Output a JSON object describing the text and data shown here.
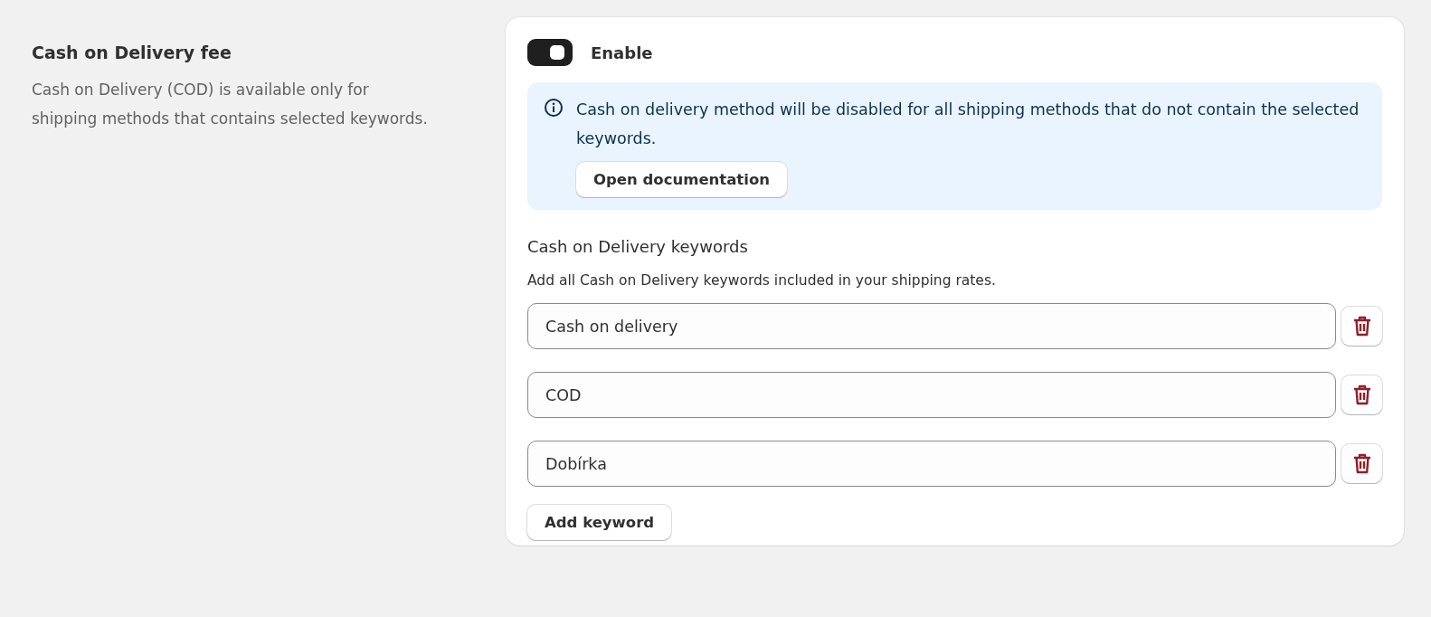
{
  "section": {
    "title": "Cash on Delivery fee",
    "description": "Cash on Delivery (COD) is available only for shipping methods that contains selected keywords."
  },
  "toggle": {
    "label": "Enable",
    "on": true
  },
  "banner": {
    "text": "Cash on delivery method will be disabled for all shipping methods that do not contain the selected keywords.",
    "button": "Open documentation"
  },
  "keywords": {
    "title": "Cash on Delivery keywords",
    "help": "Add all Cash on Delivery keywords included in your shipping rates.",
    "items": [
      {
        "value": "Cash on delivery"
      },
      {
        "value": "COD"
      },
      {
        "value": "Dobírka"
      }
    ],
    "add_button": "Add keyword"
  }
}
